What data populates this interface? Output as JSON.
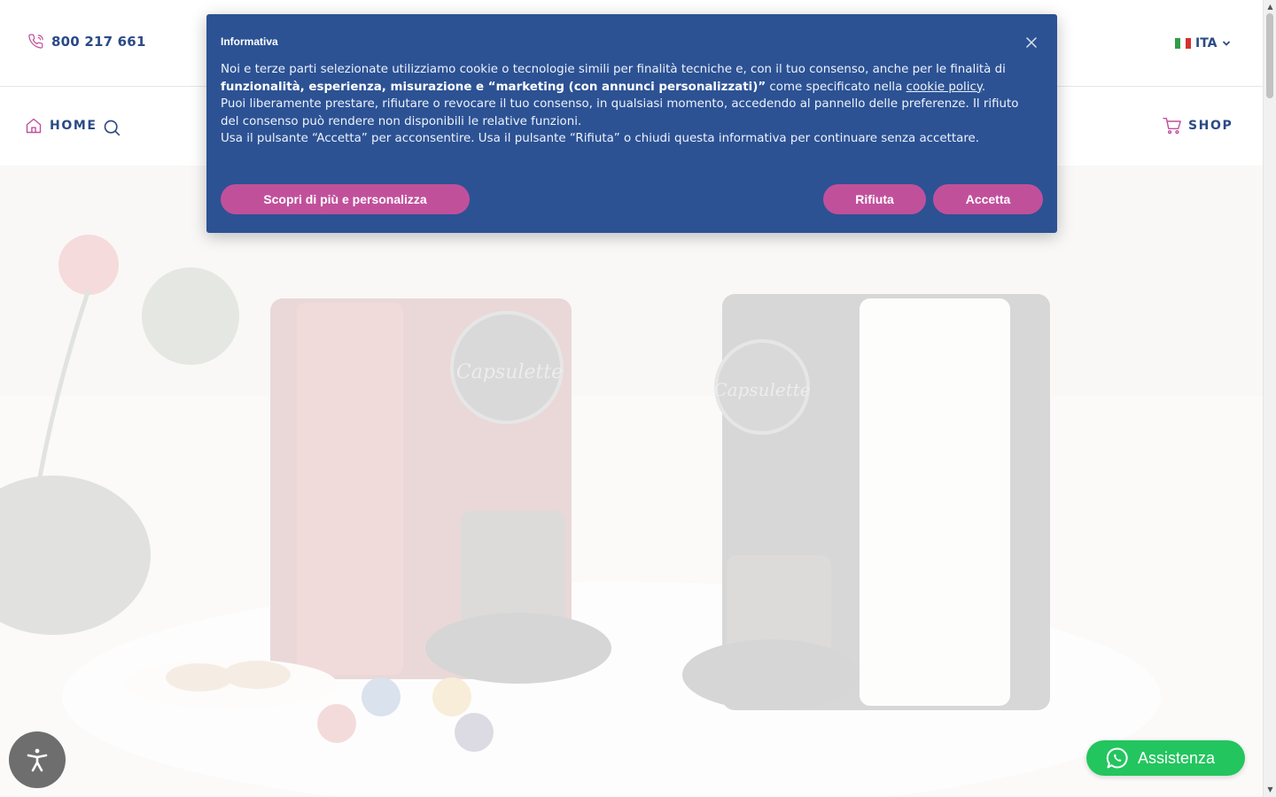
{
  "topbar": {
    "phone_number": "800 217 661",
    "phone_icon": "phone-icon",
    "language": "ITA",
    "language_flag": "italy-flag-icon"
  },
  "nav": {
    "home_label": "HOME",
    "home_icon": "home-icon",
    "search_icon": "search-icon",
    "shop_label": "SHOP",
    "shop_icon": "cart-icon"
  },
  "hero": {
    "description": "Capsulette coffee machines background image",
    "brand_mark": "Capsulette"
  },
  "cookie_banner": {
    "title": "Informativa",
    "text_line1_pre": "Noi e terze parti selezionate utilizziamo cookie o tecnologie simili per finalità tecniche e, con il tuo consenso, anche per le finalità di ",
    "text_line1_bold": "funzionalità, esperienza, misurazione e “marketing (con annunci personalizzati)”",
    "text_line1_post": " come specificato nella ",
    "policy_link": "cookie policy",
    "text_line2": "Puoi liberamente prestare, rifiutare o revocare il tuo consenso, in qualsiasi momento, accedendo al pannello delle preferenze. Il rifiuto del consenso può rendere non disponibili le relative funzioni.",
    "text_line3": "Usa il pulsante “Accetta” per acconsentire. Usa il pulsante “Rifiuta” o chiudi questa informativa per continuare senza accettare.",
    "btn_more": "Scopri di più e personalizza",
    "btn_reject": "Rifiuta",
    "btn_accept": "Accetta",
    "accent_color": "#c1509b",
    "background_color": "#2c5294"
  },
  "widgets": {
    "accessibility_icon": "accessibility-icon",
    "whatsapp_label": "Assistenza",
    "whatsapp_icon": "whatsapp-icon",
    "whatsapp_color": "#23c55e"
  },
  "colors": {
    "brand_navy": "#2b4a86",
    "brand_pink": "#c1509b"
  }
}
